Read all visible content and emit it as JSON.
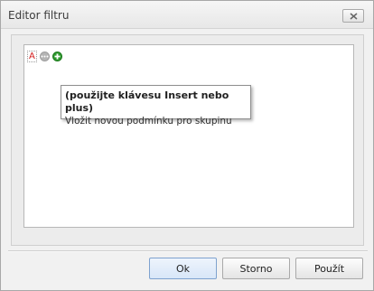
{
  "window": {
    "title": "Editor filtru",
    "close_icon": "close-x-icon"
  },
  "filter_tree": {
    "group_operator": "A",
    "group_options_icon": "ellipsis-icon",
    "add_condition_icon": "plus-circle-icon"
  },
  "tooltip": {
    "title": "(použijte klávesu Insert nebo plus)",
    "text": "Vložit novou podmínku pro skupinu"
  },
  "buttons": {
    "ok": "Ok",
    "cancel": "Storno",
    "apply": "Použít"
  },
  "colors": {
    "group_operator": "#d21a1a",
    "add_icon": "#2f9a2f",
    "default_button": "#d8e6f8"
  }
}
